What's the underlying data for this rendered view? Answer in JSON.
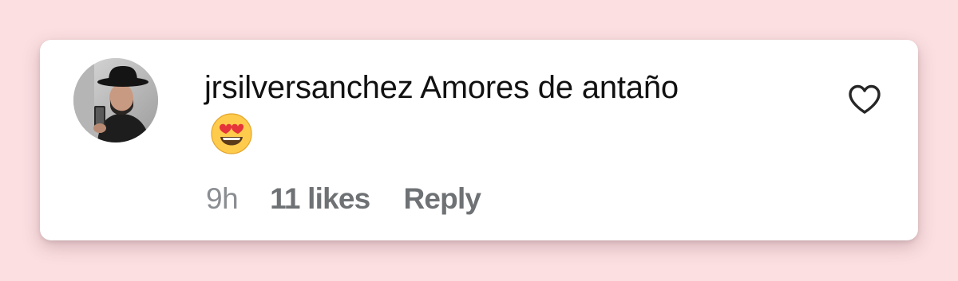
{
  "comment": {
    "username": "jrsilversanchez",
    "text": "Amores de antaño",
    "emoji_name": "smiling-face-with-heart-eyes-emoji",
    "time": "9h",
    "likes": "11 likes",
    "reply_label": "Reply"
  },
  "colors": {
    "page_background": "#fbdfe1",
    "card_background": "#ffffff",
    "primary_text": "#111111",
    "secondary_text": "#8a8d91",
    "action_text": "#6f7275"
  },
  "icons": {
    "like": "heart-outline-icon",
    "avatar": "user-profile-photo"
  }
}
